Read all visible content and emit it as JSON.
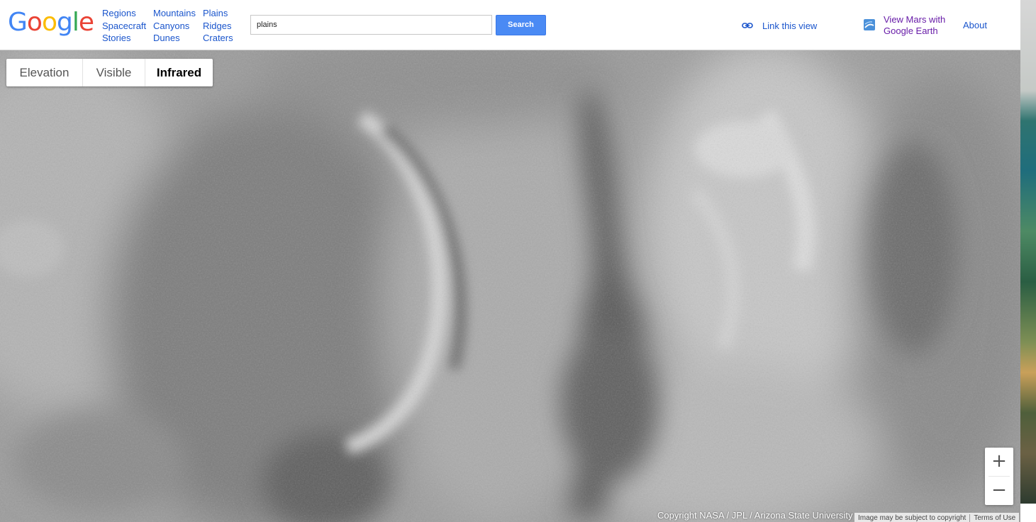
{
  "logo": {
    "letters": [
      "G",
      "o",
      "o",
      "g",
      "l",
      "e"
    ]
  },
  "nav": {
    "links": [
      "Regions",
      "Mountains",
      "Plains",
      "Spacecraft",
      "Canyons",
      "Ridges",
      "Stories",
      "Dunes",
      "Craters"
    ]
  },
  "search": {
    "value": "plains",
    "button_label": "Search"
  },
  "header_links": {
    "link_view": "Link this view",
    "earth_line1": "View Mars with",
    "earth_line2": "Google Earth",
    "about": "About"
  },
  "layer_tabs": [
    {
      "label": "Elevation",
      "active": false
    },
    {
      "label": "Visible",
      "active": false
    },
    {
      "label": "Infrared",
      "active": true
    }
  ],
  "zoom": {
    "in": "+",
    "out": "−"
  },
  "footer": {
    "copyright": "Copyright NASA / JPL / Arizona State University",
    "image_note": "Image may be subject to copyright",
    "terms": "Terms of Use"
  },
  "icons": {
    "link_icon": "chain-link-icon",
    "earth_icon": "google-earth-icon",
    "zoom_in_icon": "plus-icon",
    "zoom_out_icon": "minus-icon"
  },
  "colors": {
    "link": "#1a55cc",
    "visited_link": "#681da8",
    "search_button": "#4a8af4"
  }
}
